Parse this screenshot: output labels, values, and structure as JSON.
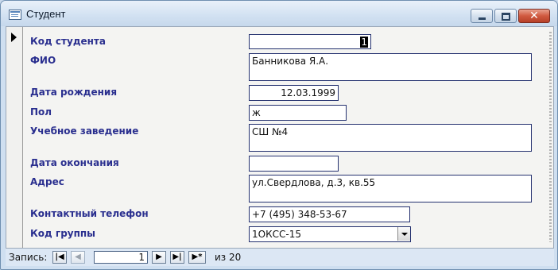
{
  "window": {
    "title": "Студент"
  },
  "form": {
    "fields": [
      {
        "label": "Код студента",
        "value": "1"
      },
      {
        "label": "ФИО",
        "value": "Банникова Я.А."
      },
      {
        "label": "Дата рождения",
        "value": "12.03.1999"
      },
      {
        "label": "Пол",
        "value": "ж"
      },
      {
        "label": "Учебное заведение",
        "value": "СШ №4"
      },
      {
        "label": "Дата окончания",
        "value": ""
      },
      {
        "label": "Адрес",
        "value": "ул.Свердлова, д.3, кв.55"
      },
      {
        "label": "Контактный телефон",
        "value": "+7 (495) 348-53-67"
      },
      {
        "label": "Код группы",
        "value": "1ОКСС-15"
      }
    ]
  },
  "navigation": {
    "label": "Запись:",
    "current": "1",
    "of_label": "из",
    "total": "20",
    "buttons": {
      "first": "|◀",
      "prev": "◀",
      "next": "▶",
      "last": "▶|",
      "new": "▶*"
    }
  },
  "icons": [
    "form-icon",
    "minimize-icon",
    "maximize-icon",
    "close-icon",
    "dropdown-arrow-icon",
    "record-selector-icon"
  ]
}
